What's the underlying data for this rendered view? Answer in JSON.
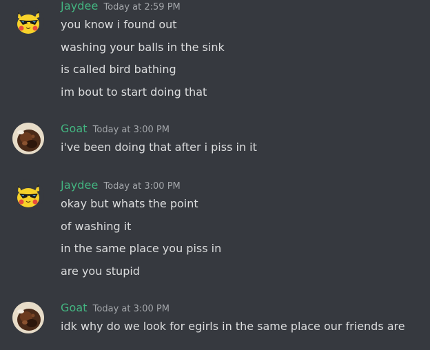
{
  "messages": [
    {
      "username": "Jaydee",
      "avatar_icon": "pikachu-sunglasses-avatar-icon",
      "timestamp": "Today at 2:59 PM",
      "lines": [
        "you know i found out",
        "washing your balls in the sink",
        "is called bird bathing",
        "im bout to start doing that"
      ]
    },
    {
      "username": "Goat",
      "avatar_icon": "goat-photo-avatar-icon",
      "timestamp": "Today at 3:00 PM",
      "lines": [
        "i've been doing that after i piss in it"
      ]
    },
    {
      "username": "Jaydee",
      "avatar_icon": "pikachu-sunglasses-avatar-icon",
      "timestamp": "Today at 3:00 PM",
      "lines": [
        "okay but whats the point",
        "of washing it",
        "in the same place you piss in",
        "are you stupid"
      ]
    },
    {
      "username": "Goat",
      "avatar_icon": "goat-photo-avatar-icon",
      "timestamp": "Today at 3:00 PM",
      "lines": [
        "idk why do we look for egirls in the same place our friends are"
      ]
    }
  ],
  "colors": {
    "background": "#36393f",
    "username": "#43b581",
    "message_text": "#dcddde",
    "timestamp": "#a3a6aa"
  }
}
